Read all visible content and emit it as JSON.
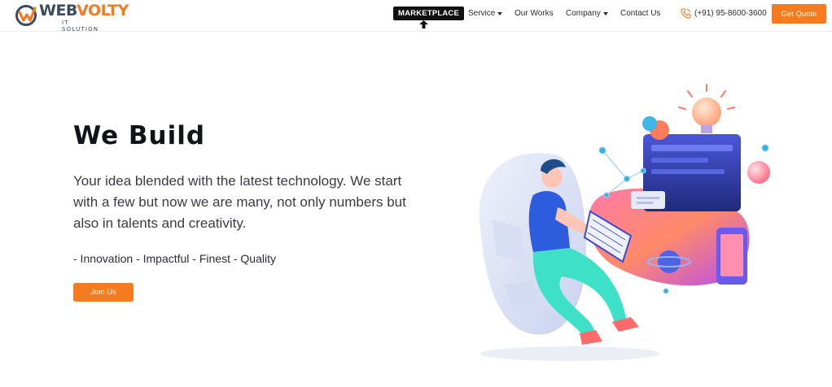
{
  "brand": {
    "name_part1": "WEB",
    "name_part2": "VOLTY",
    "tagline": "IT SOLUTION"
  },
  "nav": {
    "marketplace_label": "MARKETPLACE",
    "service_label": "Service",
    "our_works_label": "Our Works",
    "company_label": "Company",
    "contact_label": "Contact Us",
    "phone": "(+91) 95-8600-3600",
    "quote_button": "Get Quote"
  },
  "hero": {
    "title": "We Build",
    "description": "Your idea blended with the latest technology. We start with a few but now we are many, not only numbers but also in talents and creativity.",
    "tags": "- Innovation - Impactful - Finest - Quality",
    "join_button": "Join Us"
  },
  "colors": {
    "accent": "#f47b20",
    "dark": "#111318"
  },
  "icons": {
    "phone": "phone-icon",
    "arrow": "arrow-up-icon"
  }
}
